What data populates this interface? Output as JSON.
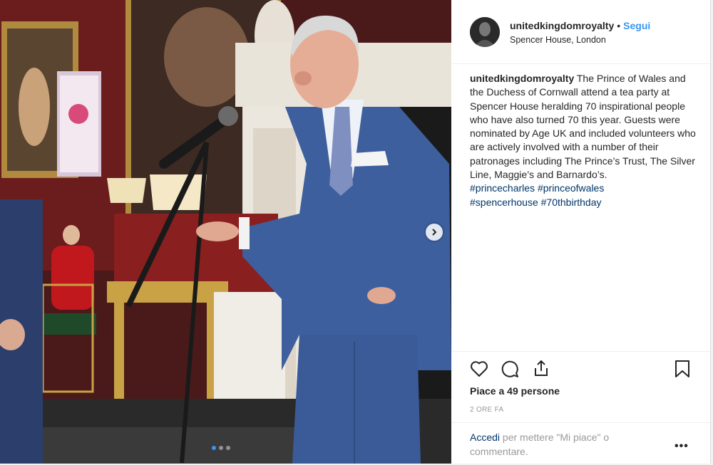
{
  "post": {
    "username": "unitedkingdomroyalty",
    "separator": "•",
    "follow_label": "Segui",
    "location": "Spencer House, London",
    "caption_text": "The Prince of Wales and the Duchess of Cornwall attend a tea party at Spencer House heralding 70 inspirational people who have also turned 70 this year. Guests were nominated by Age UK and included volunteers who are actively involved with a number of their patronages including The Prince’s Trust, The Silver Line, Maggie’s and Barnardo’s.",
    "hashtags": [
      "#princecharles",
      "#princeofwales",
      "#spencerhouse",
      "#70thbirthday"
    ],
    "likes": "Piace a 49 persone",
    "time": "2 ORE FA",
    "login_link": "Accedi",
    "login_text": " per mettere \"Mi piace\" o commentare.",
    "more_label": "•••"
  },
  "carousel": {
    "slide_count": 3,
    "active_index": 0,
    "next_icon": "chevron-right-icon"
  },
  "icons": {
    "like": "heart-icon",
    "comment": "comment-bubble-icon",
    "share": "share-upload-icon",
    "save": "bookmark-icon"
  },
  "colors": {
    "link_blue": "#3897f0",
    "hashtag_blue": "#003569",
    "text": "#262626",
    "muted": "#999999"
  }
}
